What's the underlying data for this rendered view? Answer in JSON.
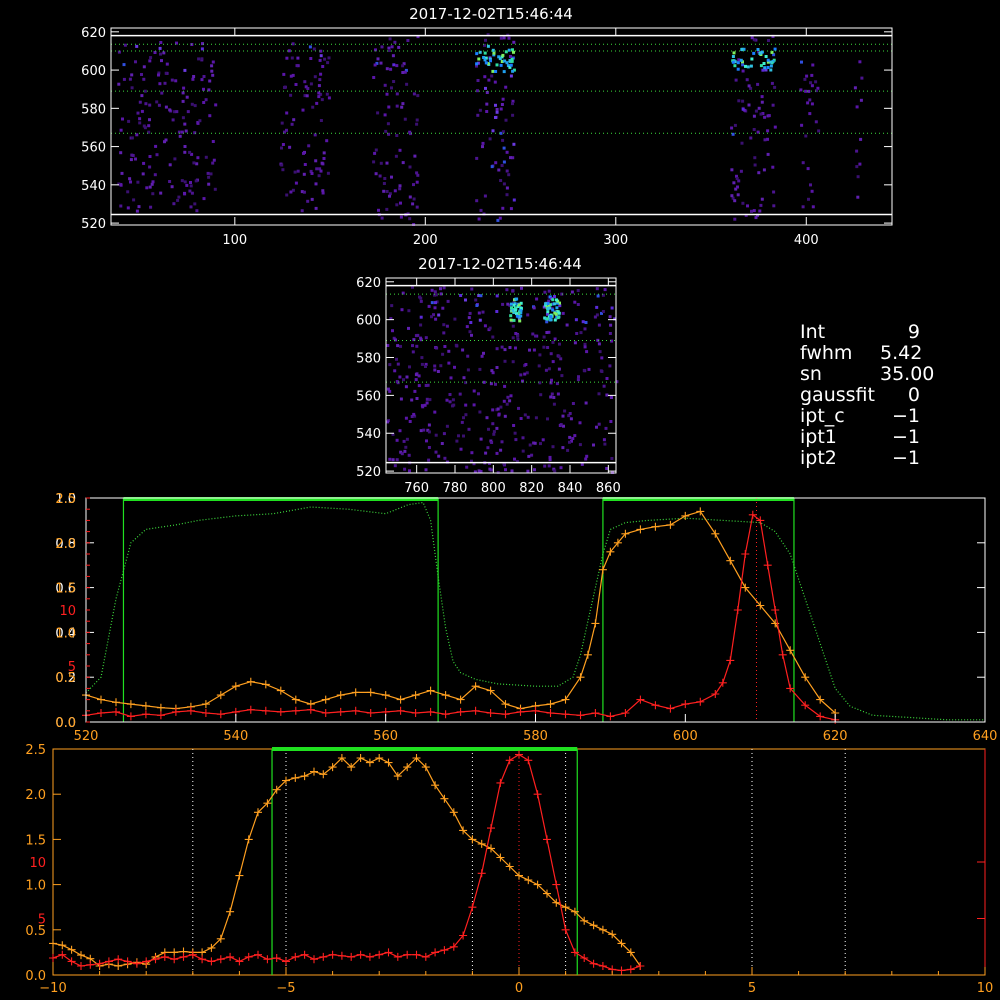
{
  "chart_data": [
    {
      "id": "top-image",
      "type": "heatmap",
      "title": "2017-12-02T15:46:44",
      "xlabel": "",
      "ylabel": "",
      "xlim": [
        35,
        445
      ],
      "ylim": [
        519,
        622
      ],
      "xticks": [
        100,
        200,
        300,
        400
      ],
      "yticks": [
        520,
        540,
        560,
        580,
        600,
        620
      ],
      "hlines_white": [
        524.5,
        618
      ],
      "hlines_dotted": [
        613.5,
        610,
        589,
        567
      ],
      "bands": [
        {
          "x0": 38,
          "x1": 90,
          "top": 616,
          "bottom": 527,
          "peak": 0.45
        },
        {
          "x0": 123,
          "x1": 149,
          "top": 617,
          "bottom": 527,
          "peak": 0.4
        },
        {
          "x0": 172,
          "x1": 196,
          "top": 620,
          "bottom": 520,
          "peak": 0.45
        },
        {
          "x0": 226,
          "x1": 246,
          "top": 620,
          "bottom": 520,
          "peak": 1.0
        },
        {
          "x0": 360,
          "x1": 383,
          "top": 620,
          "bottom": 520,
          "peak": 0.8
        },
        {
          "x0": 396,
          "x1": 406,
          "top": 612,
          "bottom": 528,
          "peak": 0.5
        },
        {
          "x0": 425,
          "x1": 429,
          "top": 612,
          "bottom": 533,
          "peak": 0.4
        }
      ]
    },
    {
      "id": "zoom-image",
      "type": "heatmap",
      "title": "2017-12-02T15:46:44",
      "xlabel": "",
      "ylabel": "",
      "xlim": [
        744,
        864
      ],
      "ylim": [
        519,
        622
      ],
      "xticks": [
        760,
        780,
        800,
        820,
        840,
        860
      ],
      "yticks": [
        520,
        540,
        560,
        580,
        600,
        620
      ],
      "hlines_white": [
        524.5,
        618
      ],
      "hlines_dotted": [
        613.5,
        589,
        567
      ],
      "bands": [
        {
          "x0": 744,
          "x1": 864,
          "top": 618,
          "bottom": 589,
          "peak": 0.45
        },
        {
          "x0": 808,
          "x1": 814,
          "top": 618,
          "bottom": 589,
          "peak": 0.75
        },
        {
          "x0": 826,
          "x1": 834,
          "top": 618,
          "bottom": 589,
          "peak": 1.0
        },
        {
          "x0": 744,
          "x1": 864,
          "top": 589,
          "bottom": 520,
          "peak": 0.3
        }
      ]
    },
    {
      "id": "profile-plot",
      "type": "line",
      "xlim": [
        520,
        640
      ],
      "xticks": [
        520,
        540,
        560,
        580,
        600,
        620,
        640
      ],
      "ylim_left": [
        0,
        1.0
      ],
      "yticks_left": [
        "0.0",
        "0.2",
        "0.4",
        "0.6",
        "0.8",
        "1.0"
      ],
      "ylim_left2": [
        0,
        2.5
      ],
      "yticks_left2": [
        "0.0",
        "0.5",
        "1.0",
        "1.5",
        "2.0",
        "2.5"
      ],
      "ylim_red": [
        0,
        20
      ],
      "yticks_red": [
        "5",
        "10"
      ],
      "green_boxes": [
        [
          525,
          567
        ],
        [
          589,
          614.5
        ]
      ],
      "red_vline": 609.5,
      "series": [
        {
          "color": "#3ddc3d",
          "x": [
            520,
            522,
            524,
            526,
            528,
            530,
            532,
            535,
            540,
            545,
            550,
            555,
            560,
            563,
            565,
            566,
            567,
            568,
            569,
            570,
            572,
            575,
            580,
            583,
            585,
            586,
            587,
            588,
            589,
            590,
            592,
            595,
            600,
            605,
            610,
            612,
            614,
            616,
            618,
            620,
            622,
            625,
            630,
            635,
            640
          ],
          "y": [
            0.13,
            0.2,
            0.55,
            0.8,
            0.86,
            0.87,
            0.88,
            0.9,
            0.92,
            0.93,
            0.96,
            0.95,
            0.93,
            0.97,
            0.98,
            0.9,
            0.65,
            0.42,
            0.27,
            0.22,
            0.19,
            0.17,
            0.16,
            0.16,
            0.2,
            0.3,
            0.45,
            0.6,
            0.75,
            0.86,
            0.89,
            0.9,
            0.91,
            0.9,
            0.89,
            0.85,
            0.75,
            0.55,
            0.35,
            0.15,
            0.07,
            0.03,
            0.02,
            0.01,
            0.01
          ]
        },
        {
          "color": "#ffa020",
          "x": [
            520,
            522,
            524,
            526,
            528,
            530,
            532,
            534,
            536,
            538,
            540,
            542,
            544,
            546,
            548,
            550,
            552,
            554,
            556,
            558,
            560,
            562,
            564,
            566,
            568,
            570,
            572,
            574,
            576,
            578,
            580,
            582,
            584,
            586,
            587,
            588,
            589,
            590,
            591,
            592,
            594,
            596,
            598,
            600,
            602,
            604,
            606,
            608,
            610,
            612,
            614,
            616,
            618,
            620
          ],
          "y": [
            0.3,
            0.25,
            0.22,
            0.2,
            0.18,
            0.16,
            0.15,
            0.17,
            0.2,
            0.3,
            0.4,
            0.45,
            0.42,
            0.35,
            0.25,
            0.2,
            0.25,
            0.3,
            0.33,
            0.33,
            0.3,
            0.25,
            0.3,
            0.35,
            0.3,
            0.25,
            0.4,
            0.35,
            0.2,
            0.15,
            0.18,
            0.2,
            0.25,
            0.5,
            0.75,
            1.1,
            1.7,
            1.9,
            2.0,
            2.1,
            2.15,
            2.18,
            2.2,
            2.3,
            2.35,
            2.1,
            1.8,
            1.5,
            1.3,
            1.1,
            0.8,
            0.5,
            0.25,
            0.1
          ]
        },
        {
          "color": "#ff2020",
          "x": [
            520,
            522,
            524,
            526,
            528,
            530,
            532,
            534,
            536,
            538,
            540,
            542,
            544,
            546,
            548,
            550,
            552,
            554,
            556,
            558,
            560,
            562,
            564,
            566,
            568,
            570,
            572,
            574,
            576,
            578,
            580,
            582,
            584,
            586,
            588,
            590,
            592,
            594,
            596,
            598,
            600,
            602,
            604,
            605,
            606,
            607,
            608,
            609,
            610,
            611,
            612,
            613,
            614,
            616,
            618,
            620
          ],
          "y": [
            0.6,
            0.8,
            0.9,
            0.5,
            0.7,
            0.6,
            0.9,
            1.0,
            0.8,
            0.7,
            0.9,
            1.1,
            1.0,
            0.9,
            1.0,
            1.1,
            0.8,
            0.9,
            1.0,
            0.8,
            0.9,
            1.0,
            0.8,
            0.9,
            0.7,
            0.9,
            1.0,
            0.8,
            0.7,
            0.9,
            1.0,
            0.8,
            0.7,
            0.6,
            0.8,
            0.5,
            0.8,
            2.0,
            1.5,
            1.2,
            1.6,
            1.8,
            2.5,
            3.5,
            5.5,
            10,
            15,
            18.5,
            18,
            14,
            10,
            6,
            3,
            1.5,
            0.5,
            0.2
          ]
        }
      ]
    },
    {
      "id": "lower-plot",
      "type": "line",
      "xlim": [
        -10,
        10
      ],
      "xticks": [
        "−10",
        "−5",
        "0",
        "5",
        "10"
      ],
      "ylim_left": [
        0,
        2.5
      ],
      "yticks_left": [
        "0.0",
        "0.5",
        "1.0",
        "1.5",
        "2.0",
        "2.5"
      ],
      "ylim_red": [
        0,
        20
      ],
      "yticks_red": [
        "5",
        "10"
      ],
      "green_box": [
        -5.3,
        1.25
      ],
      "white_vlines": [
        -7,
        -5,
        -1,
        1,
        5,
        7
      ],
      "red_vline": 0,
      "series": [
        {
          "color": "#ffa020",
          "x": [
            -10,
            -9.8,
            -9.6,
            -9.4,
            -9.2,
            -9,
            -8.8,
            -8.6,
            -8.4,
            -8.2,
            -8,
            -7.8,
            -7.6,
            -7.4,
            -7.2,
            -7,
            -6.8,
            -6.6,
            -6.4,
            -6.2,
            -6,
            -5.8,
            -5.6,
            -5.4,
            -5.2,
            -5,
            -4.8,
            -4.6,
            -4.4,
            -4.2,
            -4,
            -3.8,
            -3.6,
            -3.4,
            -3.2,
            -3,
            -2.8,
            -2.6,
            -2.4,
            -2.2,
            -2,
            -1.8,
            -1.6,
            -1.4,
            -1.2,
            -1,
            -0.8,
            -0.6,
            -0.4,
            -0.2,
            0,
            0.2,
            0.4,
            0.6,
            0.8,
            1,
            1.2,
            1.4,
            1.6,
            1.8,
            2,
            2.2,
            2.4,
            2.6
          ],
          "y": [
            0.35,
            0.33,
            0.28,
            0.22,
            0.18,
            0.1,
            0.12,
            0.1,
            0.12,
            0.14,
            0.12,
            0.2,
            0.25,
            0.25,
            0.26,
            0.25,
            0.25,
            0.3,
            0.4,
            0.7,
            1.1,
            1.5,
            1.8,
            1.9,
            2.05,
            2.15,
            2.18,
            2.2,
            2.25,
            2.22,
            2.3,
            2.4,
            2.3,
            2.4,
            2.35,
            2.4,
            2.35,
            2.2,
            2.3,
            2.4,
            2.3,
            2.1,
            1.95,
            1.8,
            1.6,
            1.5,
            1.45,
            1.4,
            1.3,
            1.2,
            1.1,
            1.05,
            1.0,
            0.9,
            0.8,
            0.75,
            0.7,
            0.6,
            0.55,
            0.5,
            0.45,
            0.35,
            0.25,
            0.1
          ]
        },
        {
          "color": "#ff2020",
          "x": [
            -10,
            -9.8,
            -9.6,
            -9.4,
            -9.2,
            -9,
            -8.8,
            -8.6,
            -8.4,
            -8.2,
            -8,
            -7.8,
            -7.6,
            -7.4,
            -7.2,
            -7,
            -6.8,
            -6.6,
            -6.4,
            -6.2,
            -6,
            -5.8,
            -5.6,
            -5.4,
            -5.2,
            -5,
            -4.8,
            -4.6,
            -4.4,
            -4.2,
            -4,
            -3.8,
            -3.6,
            -3.4,
            -3.2,
            -3,
            -2.8,
            -2.6,
            -2.4,
            -2.2,
            -2,
            -1.8,
            -1.6,
            -1.4,
            -1.2,
            -1,
            -0.8,
            -0.6,
            -0.4,
            -0.2,
            0,
            0.2,
            0.4,
            0.6,
            0.8,
            1,
            1.2,
            1.4,
            1.6,
            1.8,
            2,
            2.2,
            2.4,
            2.6
          ],
          "y": [
            1.5,
            1.8,
            1.2,
            0.8,
            0.9,
            1.0,
            1.2,
            1.4,
            1.2,
            1.0,
            1.2,
            1.4,
            1.6,
            1.4,
            1.6,
            1.8,
            1.4,
            1.2,
            1.4,
            1.6,
            1.2,
            1.6,
            1.8,
            1.4,
            1.5,
            1.2,
            1.6,
            1.8,
            1.4,
            1.6,
            1.8,
            1.7,
            1.6,
            1.8,
            1.6,
            1.8,
            2.0,
            1.6,
            1.8,
            1.8,
            1.6,
            2.0,
            2.2,
            2.5,
            3.5,
            6,
            9,
            13,
            17,
            19,
            19.5,
            19,
            16,
            12,
            8,
            4,
            2,
            1.5,
            1.0,
            0.8,
            0.5,
            0.4,
            0.5,
            0.8
          ]
        }
      ]
    }
  ],
  "info": {
    "rows": [
      {
        "key": "Int",
        "value": "9"
      },
      {
        "key": "fwhm",
        "value": "5.42"
      },
      {
        "key": "sn",
        "value": "35.00"
      },
      {
        "key": "gaussfit",
        "value": "0"
      },
      {
        "key": "ipt_c",
        "value": "−1"
      },
      {
        "key": "ipt1",
        "value": "−1"
      },
      {
        "key": "ipt2",
        "value": "−1"
      }
    ]
  },
  "colors": {
    "axes": "#ffffff",
    "profile_axes": "#ffa020",
    "red_axis": "#ff2020",
    "green_box": "#20e020",
    "dotted_green": "#3ddc3d"
  }
}
